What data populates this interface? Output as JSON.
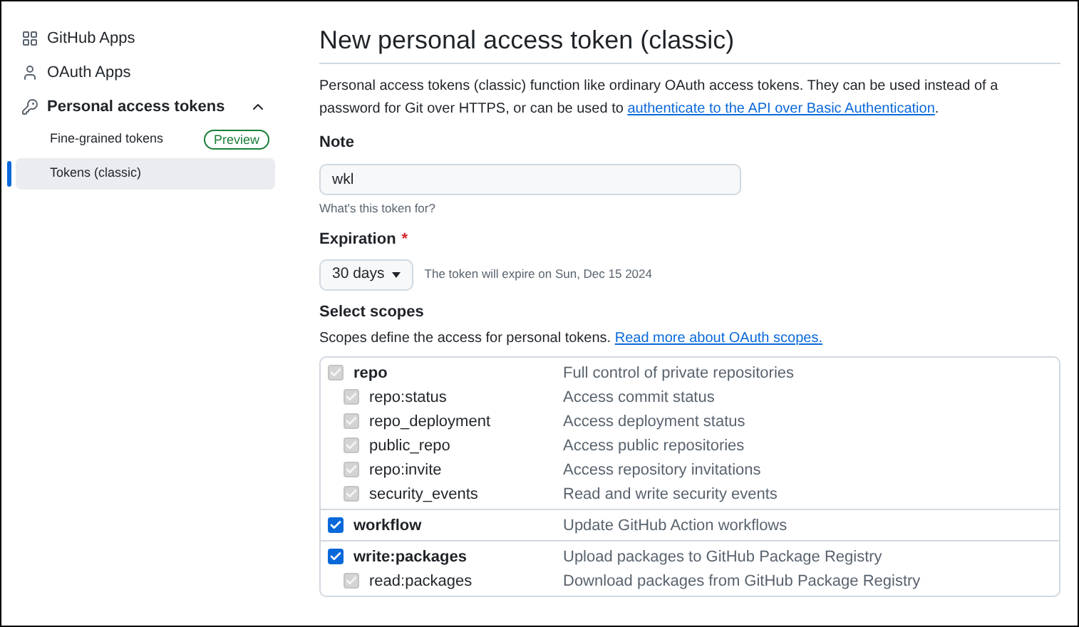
{
  "sidebar": {
    "items": [
      {
        "label": "GitHub Apps",
        "selected": false
      },
      {
        "label": "OAuth Apps",
        "selected": false
      },
      {
        "label": "Personal access tokens",
        "selected": false,
        "expanded": true,
        "children": [
          {
            "label": "Fine-grained tokens",
            "badge": "Preview",
            "selected": false
          },
          {
            "label": "Tokens (classic)",
            "selected": true
          }
        ]
      }
    ]
  },
  "page": {
    "title": "New personal access token (classic)",
    "intro": "Personal access tokens (classic) function like ordinary OAuth access tokens. They can be used instead of a password for Git over HTTPS, or can be used to ",
    "intro_link": "authenticate to the API over Basic Authentication",
    "intro_end": "."
  },
  "note": {
    "label": "Note",
    "value": "wkl",
    "hint": "What's this token for?"
  },
  "expiration": {
    "label": "Expiration",
    "required_mark": "*",
    "value": "30 days",
    "hint": "The token will expire on Sun, Dec 15 2024"
  },
  "scopes": {
    "heading": "Select scopes",
    "description": "Scopes define the access for personal tokens. ",
    "link": "Read more about OAuth scopes.",
    "groups": [
      {
        "name": "repo",
        "description": "Full control of private repositories",
        "checked": true,
        "disabled": true,
        "children": [
          {
            "name": "repo:status",
            "description": "Access commit status",
            "checked": true,
            "disabled": true
          },
          {
            "name": "repo_deployment",
            "description": "Access deployment status",
            "checked": true,
            "disabled": true
          },
          {
            "name": "public_repo",
            "description": "Access public repositories",
            "checked": true,
            "disabled": true
          },
          {
            "name": "repo:invite",
            "description": "Access repository invitations",
            "checked": true,
            "disabled": true
          },
          {
            "name": "security_events",
            "description": "Read and write security events",
            "checked": true,
            "disabled": true
          }
        ]
      },
      {
        "name": "workflow",
        "description": "Update GitHub Action workflows",
        "checked": true,
        "disabled": false
      },
      {
        "name": "write:packages",
        "description": "Upload packages to GitHub Package Registry",
        "checked": true,
        "disabled": false,
        "children": [
          {
            "name": "read:packages",
            "description": "Download packages from GitHub Package Registry",
            "checked": true,
            "disabled": true
          }
        ]
      }
    ]
  }
}
